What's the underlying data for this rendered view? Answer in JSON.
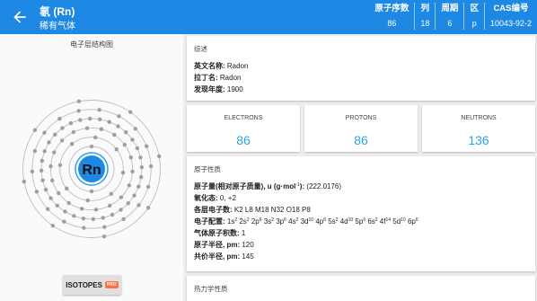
{
  "header": {
    "title": "氡 (Rn)",
    "subtitle": "稀有气体",
    "props": [
      {
        "label": "原子序数",
        "value": "86"
      },
      {
        "label": "列",
        "value": "18"
      },
      {
        "label": "周期",
        "value": "6"
      },
      {
        "label": "区",
        "value": "p"
      },
      {
        "label": "CAS编号",
        "value": "10043-92-2"
      }
    ]
  },
  "left": {
    "diagram_title": "电子层结构图",
    "symbol": "Rn",
    "shells": [
      2,
      8,
      18,
      32,
      18,
      8
    ],
    "isotopes_label": "ISOTOPES",
    "pro_badge": "PRO",
    "colors": {
      "nucleus": "#1e88e5",
      "nucleus_ring": "#29a3e6",
      "electron": "#9e9e9e",
      "shell": "#bdbdbd"
    }
  },
  "overview": {
    "heading": "综述",
    "rows": [
      {
        "label": "英文名称: ",
        "value": "Radon"
      },
      {
        "label": "拉丁名: ",
        "value": "Radon"
      },
      {
        "label": "发现年度: ",
        "value": "1900"
      }
    ]
  },
  "stats": [
    {
      "label": "ELECTRONS",
      "value": "86"
    },
    {
      "label": "PROTONS",
      "value": "86"
    },
    {
      "label": "NEUTRONS",
      "value": "136"
    }
  ],
  "atomic": {
    "heading": "原子性质",
    "mass_label": "原子量(相对原子质量), u (g·mol",
    "mass_sup": "-1",
    "mass_close": "): ",
    "mass_value": "(222.0176)",
    "ox_label": "氧化态: ",
    "ox_value": "0, +2",
    "shells_label": "各层电子数: ",
    "shells_value": "K2 L8 M18 N32 O18 P8",
    "config_label": "电子配置: ",
    "config": [
      {
        "o": "1s",
        "e": "2"
      },
      {
        "o": "2s",
        "e": "2"
      },
      {
        "o": "2p",
        "e": "6"
      },
      {
        "o": "3s",
        "e": "2"
      },
      {
        "o": "3p",
        "e": "6"
      },
      {
        "o": "4s",
        "e": "2"
      },
      {
        "o": "3d",
        "e": "10"
      },
      {
        "o": "4p",
        "e": "6"
      },
      {
        "o": "5s",
        "e": "2"
      },
      {
        "o": "4d",
        "e": "10"
      },
      {
        "o": "5p",
        "e": "6"
      },
      {
        "o": "6s",
        "e": "2"
      },
      {
        "o": "4f",
        "e": "14"
      },
      {
        "o": "5d",
        "e": "10"
      },
      {
        "o": "6p",
        "e": "6"
      }
    ],
    "valence_label": "气体原子积数: ",
    "valence_value": "1",
    "radius_label": "原子半径, pm: ",
    "radius_value": "120",
    "covalent_label": "共价半径, pm: ",
    "covalent_value": "145"
  },
  "thermo": {
    "heading": "热力学性质"
  }
}
